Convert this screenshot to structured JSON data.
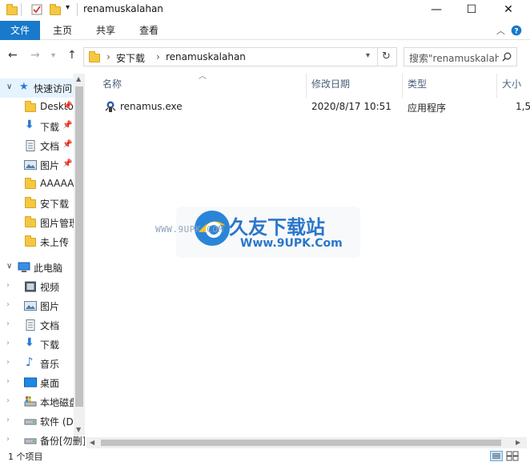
{
  "window": {
    "title": "renamuskalahan",
    "controls": {
      "minimize": "—",
      "maximize": "☐",
      "close": "✕"
    }
  },
  "ribbon": {
    "tabs": [
      "文件",
      "主页",
      "共享",
      "查看"
    ],
    "collapse_icon": "chevron-up-icon",
    "help_icon": "help-icon"
  },
  "address": {
    "path": [
      "安下载",
      "renamuskalahan"
    ],
    "search_placeholder": "搜索\"renamuskalahan\""
  },
  "nav": {
    "quick_access_label": "快速访问",
    "quick_items": [
      {
        "label": "Desktop",
        "icon": "folder-icon",
        "pinned": true
      },
      {
        "label": "下载",
        "icon": "download-icon",
        "pinned": true
      },
      {
        "label": "文档",
        "icon": "document-icon",
        "pinned": true
      },
      {
        "label": "图片",
        "icon": "picture-icon",
        "pinned": true
      },
      {
        "label": "AAAAA",
        "icon": "folder-icon",
        "pinned": false
      },
      {
        "label": "安下载",
        "icon": "folder-icon",
        "pinned": false
      },
      {
        "label": "图片管理",
        "icon": "folder-icon",
        "pinned": false
      },
      {
        "label": "未上传",
        "icon": "folder-icon",
        "pinned": false
      }
    ],
    "this_pc_label": "此电脑",
    "pc_items": [
      {
        "label": "视频",
        "icon": "video-icon"
      },
      {
        "label": "图片",
        "icon": "picture-icon"
      },
      {
        "label": "文档",
        "icon": "document-icon"
      },
      {
        "label": "下载",
        "icon": "download-icon"
      },
      {
        "label": "音乐",
        "icon": "music-icon"
      },
      {
        "label": "桌面",
        "icon": "desktop-icon"
      },
      {
        "label": "本地磁盘 (C:)",
        "icon": "drive-icon"
      },
      {
        "label": "软件 (D:)",
        "icon": "drive-icon"
      },
      {
        "label": "备份[勿删] (E:)",
        "icon": "drive-icon"
      }
    ]
  },
  "columns": {
    "name": "名称",
    "date": "修改日期",
    "type": "类型",
    "size": "大小"
  },
  "files": [
    {
      "name": "renamus.exe",
      "date": "2020/8/17 10:51",
      "type": "应用程序",
      "size": "1,5"
    }
  ],
  "watermark": {
    "brand": "久友下载站",
    "url_left": "WWW.9UPK.COM",
    "url_right": "Www.9UPK.Com"
  },
  "status": {
    "count": "1 个项目"
  },
  "colors": {
    "accent": "#1979ca",
    "folder": "#f5c842"
  }
}
